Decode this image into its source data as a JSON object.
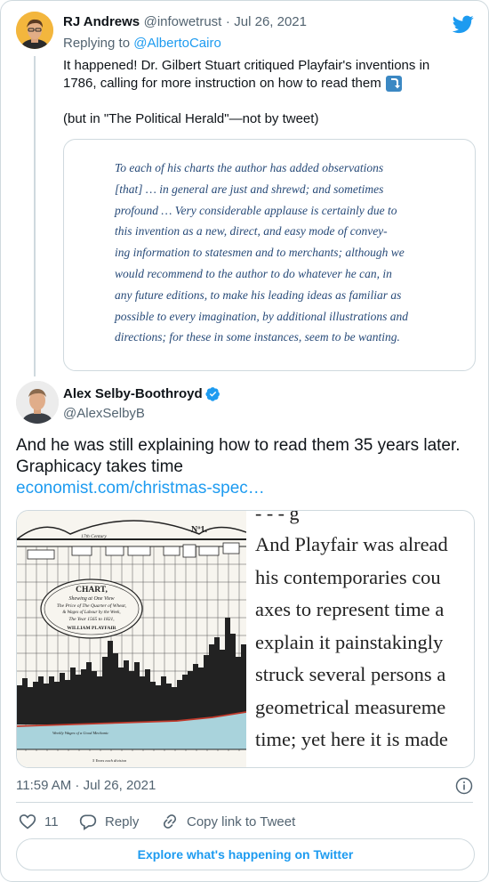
{
  "tweet1": {
    "name": "RJ Andrews",
    "handle": "@infowetrust",
    "sep": "·",
    "date": "Jul 26, 2021",
    "replying_prefix": "Replying to ",
    "replying_to": "@AlbertoCairo",
    "line1": "It happened! Dr. Gilbert Stuart critiqued Playfair's inventions in",
    "line2": "1786, calling for more instruction on how to read them",
    "line3": "(but in \"The Political Herald\"—not by tweet)",
    "quote_lines": [
      "To each of his charts the author has added observations",
      "[that] … in general are just and shrewd; and sometimes",
      "profound … Very considerable applause is certainly due to",
      "this invention as a new, direct, and easy mode of convey-",
      "ing information to statesmen and to merchants; although we",
      "would recommend to the author to do whatever he can, in",
      "any future editions, to make his leading ideas as familiar as",
      "possible to every imagination, by additional illustrations and",
      "directions; for these in some instances, seem to be wanting."
    ]
  },
  "tweet2": {
    "name": "Alex Selby-Boothroyd",
    "handle": "@AlexSelbyB",
    "line1": "And he was still explaining how to read them 35 years later.",
    "line2": "Graphicacy takes time",
    "link": "economist.com/christmas-spec…",
    "chart_labels": {
      "number": "Nº1.",
      "century": "17th Century",
      "chart_title": "CHART,",
      "shewing": "Shewing at One View",
      "price": "The Price of The Quarter of Wheat,",
      "wages": "& Wages of Labour by the Week,",
      "years": "The Year 1565 to 1821,",
      "author": "WILLIAM PLAYFAIR",
      "wages_line": "Weekly Wages of a Good Mechanic",
      "footer": "5 Years each division"
    },
    "excerpt_lines": [
      "And Playfair was alread",
      "his contemporaries cou",
      "axes to represent time a",
      "explain it painstakingly",
      "struck several persons a",
      "geometrical measureme",
      "time; yet here it is made"
    ],
    "top_fragment": "- - -     g",
    "timestamp": "11:59 AM · Jul 26, 2021",
    "likes": "11",
    "reply_label": "Reply",
    "copy_label": "Copy link to Tweet",
    "explore_label": "Explore what's happening on Twitter"
  },
  "colors": {
    "accent": "#1d9bf0",
    "text": "#0f1419",
    "muted": "#536471",
    "border": "#cfd9de",
    "quote_blue": "#274a78"
  }
}
